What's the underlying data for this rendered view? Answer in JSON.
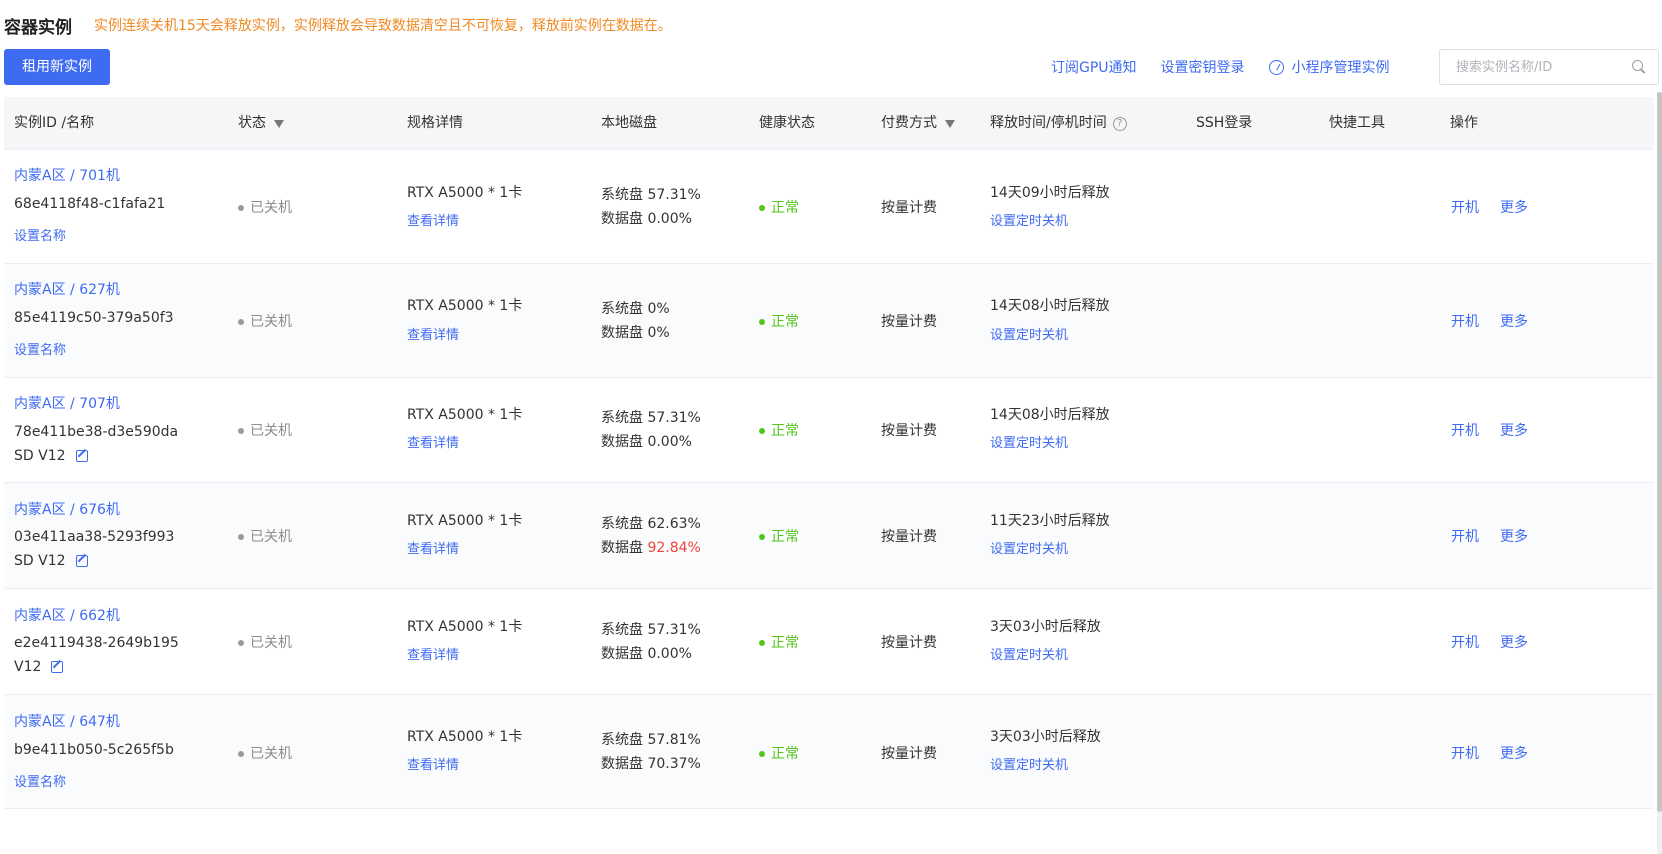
{
  "header": {
    "title": "容器实例",
    "warning": "实例连续关机15天会释放实例，实例释放会导致数据清空且不可恢复，释放前实例在数据在。"
  },
  "toolbar": {
    "rent_button": "租用新实例",
    "links": [
      "订阅GPU通知",
      "设置密钥登录",
      "小程序管理实例"
    ],
    "search_placeholder": "搜索实例名称/ID"
  },
  "columns": {
    "id_name": "实例ID /名称",
    "status": "状态",
    "spec": "规格详情",
    "disk": "本地磁盘",
    "health": "健康状态",
    "billing": "付费方式",
    "release": "释放时间/停机时间",
    "ssh": "SSH登录",
    "tools": "快捷工具",
    "actions": "操作"
  },
  "rows": [
    {
      "region": "内蒙A区 / 701机",
      "id": "68e4118f48-c1fafa21",
      "name": "",
      "set_name": "设置名称",
      "status": "已关机",
      "spec": "RTX A5000 * 1卡",
      "spec_link": "查看详情",
      "sys_disk": "系统盘 57.31%",
      "data_disk_label": "数据盘",
      "data_disk_value": "0.00%",
      "data_warn": false,
      "health": "正常",
      "billing": "按量计费",
      "release": "14天09小时后释放",
      "release_link": "设置定时关机",
      "action_start": "开机",
      "action_more": "更多"
    },
    {
      "region": "内蒙A区 / 627机",
      "id": "85e4119c50-379a50f3",
      "name": "",
      "set_name": "设置名称",
      "status": "已关机",
      "spec": "RTX A5000 * 1卡",
      "spec_link": "查看详情",
      "sys_disk": "系统盘 0%",
      "data_disk_label": "数据盘",
      "data_disk_value": "0%",
      "data_warn": false,
      "health": "正常",
      "billing": "按量计费",
      "release": "14天08小时后释放",
      "release_link": "设置定时关机",
      "action_start": "开机",
      "action_more": "更多"
    },
    {
      "region": "内蒙A区 / 707机",
      "id": "78e411be38-d3e590da",
      "name": "SD V12",
      "set_name": "",
      "status": "已关机",
      "spec": "RTX A5000 * 1卡",
      "spec_link": "查看详情",
      "sys_disk": "系统盘 57.31%",
      "data_disk_label": "数据盘",
      "data_disk_value": "0.00%",
      "data_warn": false,
      "health": "正常",
      "billing": "按量计费",
      "release": "14天08小时后释放",
      "release_link": "设置定时关机",
      "action_start": "开机",
      "action_more": "更多"
    },
    {
      "region": "内蒙A区 / 676机",
      "id": "03e411aa38-5293f993",
      "name": "SD V12",
      "set_name": "",
      "status": "已关机",
      "spec": "RTX A5000 * 1卡",
      "spec_link": "查看详情",
      "sys_disk": "系统盘 62.63%",
      "data_disk_label": "数据盘",
      "data_disk_value": "92.84%",
      "data_warn": true,
      "health": "正常",
      "billing": "按量计费",
      "release": "11天23小时后释放",
      "release_link": "设置定时关机",
      "action_start": "开机",
      "action_more": "更多"
    },
    {
      "region": "内蒙A区 / 662机",
      "id": "e2e4119438-2649b195",
      "name": "V12",
      "set_name": "",
      "status": "已关机",
      "spec": "RTX A5000 * 1卡",
      "spec_link": "查看详情",
      "sys_disk": "系统盘 57.31%",
      "data_disk_label": "数据盘",
      "data_disk_value": "0.00%",
      "data_warn": false,
      "health": "正常",
      "billing": "按量计费",
      "release": "3天03小时后释放",
      "release_link": "设置定时关机",
      "action_start": "开机",
      "action_more": "更多"
    },
    {
      "region": "内蒙A区 / 647机",
      "id": "b9e411b050-5c265f5b",
      "name": "",
      "set_name": "设置名称",
      "status": "已关机",
      "spec": "RTX A5000 * 1卡",
      "spec_link": "查看详情",
      "sys_disk": "系统盘 57.81%",
      "data_disk_label": "数据盘",
      "data_disk_value": "70.37%",
      "data_warn": false,
      "health": "正常",
      "billing": "按量计费",
      "release": "3天03小时后释放",
      "release_link": "设置定时关机",
      "action_start": "开机",
      "action_more": "更多"
    }
  ],
  "colors": {
    "primary": "#3f6bf2",
    "warning": "#f08a24",
    "success": "#52c41a",
    "danger": "#f0443a",
    "muted": "#8c8c8c"
  }
}
